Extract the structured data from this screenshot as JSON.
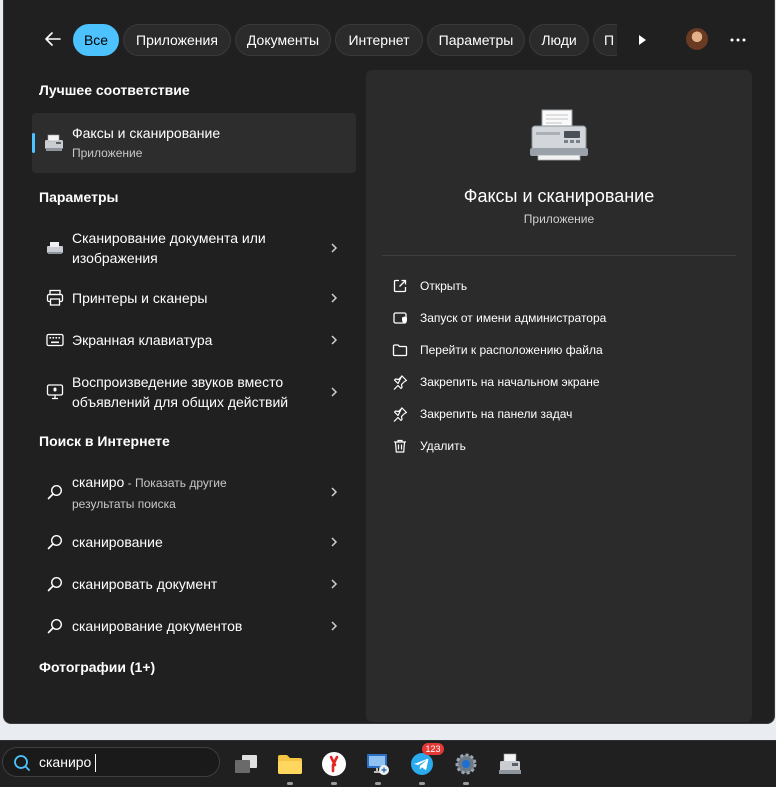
{
  "filters": {
    "back_icon": "arrow-left-icon",
    "chips": [
      "Все",
      "Приложения",
      "Документы",
      "Интернет",
      "Параметры",
      "Люди",
      "П"
    ],
    "more_icon": "play-icon",
    "menu_icon": "more-icon"
  },
  "best_match": {
    "heading": "Лучшее соответствие",
    "title": "Факсы и сканирование",
    "subtitle": "Приложение"
  },
  "settings": {
    "heading": "Параметры",
    "items": [
      {
        "line1": "Сканирование документа или",
        "line2": "изображения",
        "icon": "scanner-icon"
      },
      {
        "line1": "Принтеры и сканеры",
        "icon": "printer-icon"
      },
      {
        "line1": "Экранная клавиатура",
        "icon": "keyboard-icon"
      },
      {
        "line1": "Воспроизведение звуков вместо",
        "line2": "объявлений для общих действий",
        "icon": "monitor-sound-icon"
      }
    ]
  },
  "web": {
    "heading": "Поиск в Интернете",
    "items": [
      {
        "query": "сканиро",
        "hint": " - Показать другие",
        "hint2": "результаты поиска"
      },
      {
        "query": "сканирование"
      },
      {
        "query": "сканировать документ"
      },
      {
        "query": "сканирование документов"
      }
    ]
  },
  "photos": {
    "heading": "Фотографии (1+)"
  },
  "details": {
    "title": "Факсы и сканирование",
    "subtitle": "Приложение",
    "actions": [
      {
        "label": "Открыть",
        "icon": "open-external-icon"
      },
      {
        "label": "Запуск от имени администратора",
        "icon": "shield-icon"
      },
      {
        "label": "Перейти к расположению файла",
        "icon": "folder-icon"
      },
      {
        "label": "Закрепить на начальном экране",
        "icon": "pin-icon"
      },
      {
        "label": "Закрепить на панели задач",
        "icon": "pin-icon"
      },
      {
        "label": "Удалить",
        "icon": "trash-icon"
      }
    ]
  },
  "taskbar": {
    "query": "сканиро",
    "telegram_badge": "123"
  }
}
